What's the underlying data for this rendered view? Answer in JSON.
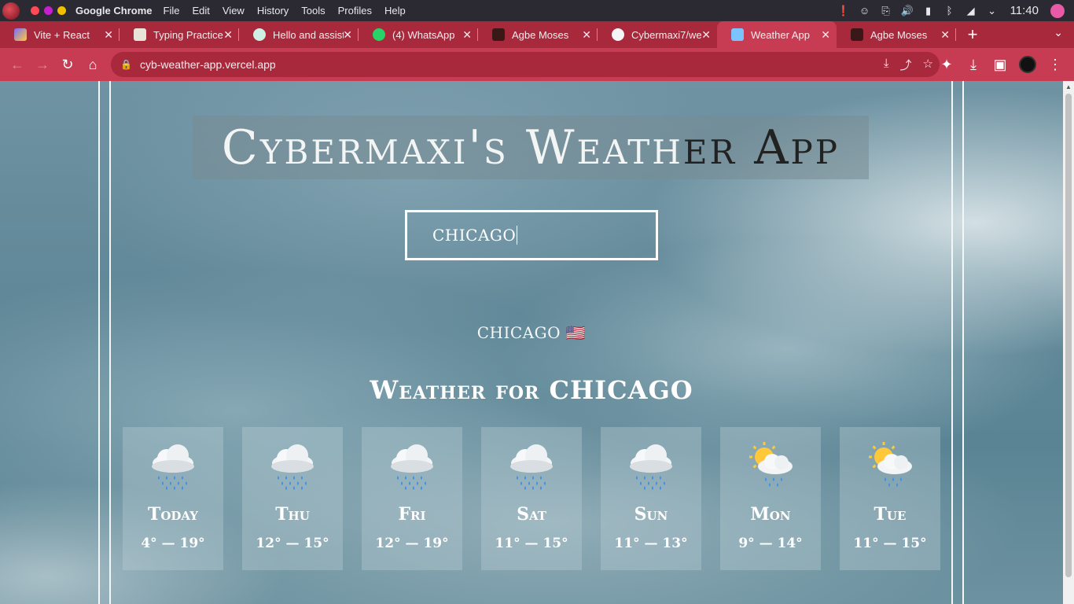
{
  "system_bar": {
    "app_name": "Google Chrome",
    "menu": [
      "File",
      "Edit",
      "View",
      "History",
      "Tools",
      "Profiles",
      "Help"
    ],
    "clock": "11:40"
  },
  "tabs": [
    {
      "title": "Vite + React",
      "icon": "vite-icon",
      "active": false
    },
    {
      "title": "Typing Practice",
      "icon": "typing-icon",
      "active": false
    },
    {
      "title": "Hello and assist",
      "icon": "chatgpt-icon",
      "active": false
    },
    {
      "title": "(4) WhatsApp",
      "icon": "whatsapp-icon",
      "active": false
    },
    {
      "title": "Agbe Moses",
      "icon": "avatar-icon",
      "active": false
    },
    {
      "title": "Cybermaxi7/we",
      "icon": "github-icon",
      "active": false
    },
    {
      "title": "Weather App",
      "icon": "weather-icon",
      "active": true
    },
    {
      "title": "Agbe Moses",
      "icon": "avatar-icon",
      "active": false
    }
  ],
  "address_bar": {
    "url": "cyb-weather-app.vercel.app"
  },
  "app": {
    "title_light": "Cybermaxi's Weath",
    "title_dark": "er App",
    "search_value": "CHICAGO",
    "city_label": "CHICAGO 🇺🇸",
    "heading": "Weather for CHICAGO"
  },
  "forecast": [
    {
      "day": "Today",
      "temps": "4° — 19°",
      "icon": "rain-cloud-icon"
    },
    {
      "day": "Thu",
      "temps": "12° — 15°",
      "icon": "rain-cloud-icon"
    },
    {
      "day": "Fri",
      "temps": "12° — 19°",
      "icon": "rain-cloud-icon"
    },
    {
      "day": "Sat",
      "temps": "11° — 15°",
      "icon": "rain-cloud-icon"
    },
    {
      "day": "Sun",
      "temps": "11° — 13°",
      "icon": "rain-cloud-icon"
    },
    {
      "day": "Mon",
      "temps": "9° — 14°",
      "icon": "sun-rain-cloud-icon"
    },
    {
      "day": "Tue",
      "temps": "11° — 15°",
      "icon": "sun-rain-cloud-icon"
    }
  ],
  "colors": {
    "tab_strip": "#a8283c",
    "toolbar": "#c73c52",
    "sky": "#5f8797"
  }
}
